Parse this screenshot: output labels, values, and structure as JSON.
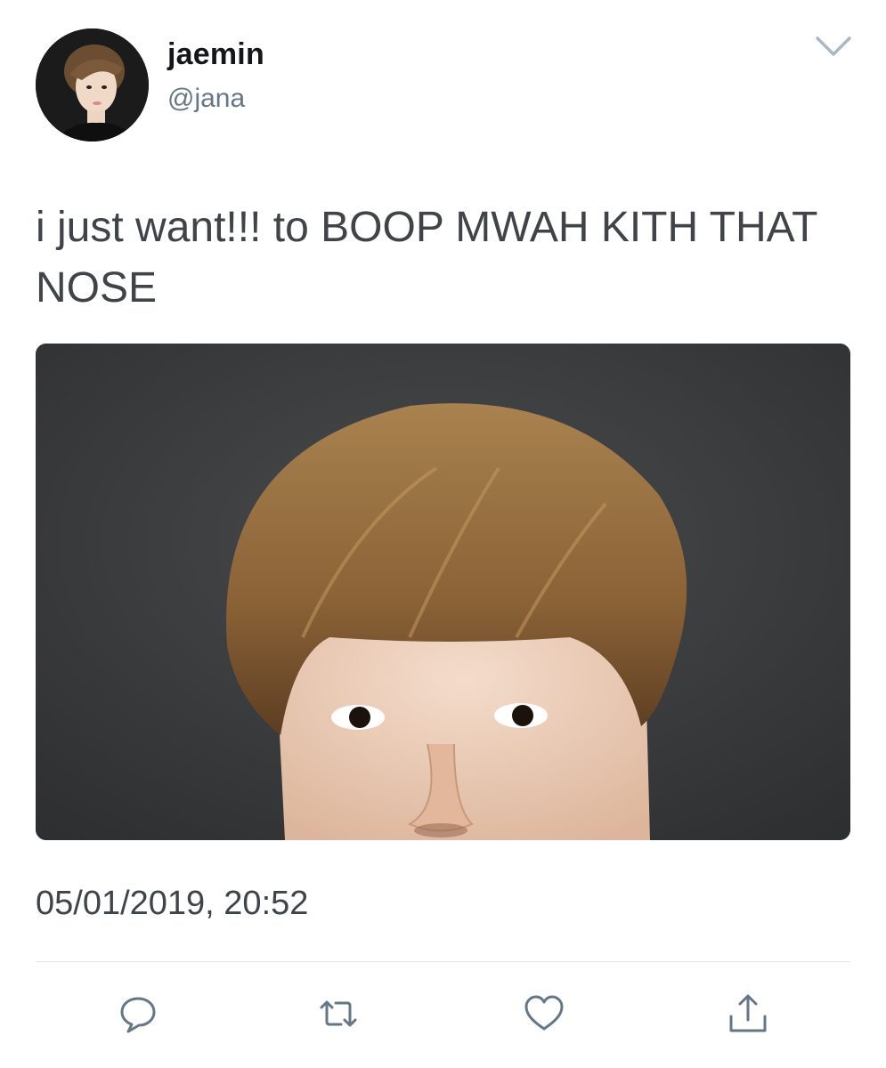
{
  "author": {
    "display_name": "jaemin",
    "handle": "@jana",
    "avatar_icon": "profile-photo"
  },
  "tweet": {
    "text": "i just want!!! to BOOP MWAH KITH THAT NOSE",
    "timestamp": "05/01/2019, 20:52",
    "media_icon": "attached-photo"
  },
  "actions": {
    "reply_icon": "reply-icon",
    "retweet_icon": "retweet-icon",
    "like_icon": "heart-icon",
    "share_icon": "share-icon"
  },
  "colors": {
    "icon": "#657786",
    "text": "#404448",
    "name": "#14171a",
    "divider": "#e1e8ed"
  }
}
